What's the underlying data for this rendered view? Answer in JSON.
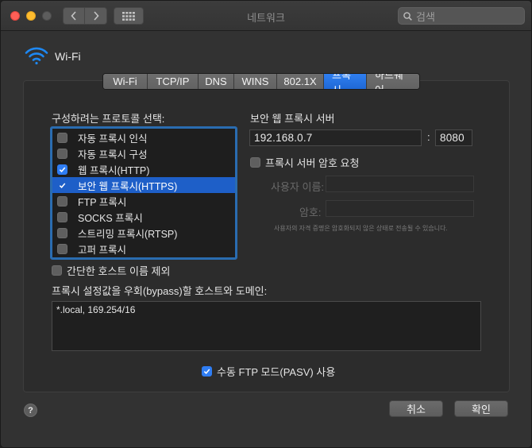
{
  "window": {
    "title": "네트워크"
  },
  "search": {
    "placeholder": "검색"
  },
  "header": {
    "service_name": "Wi-Fi"
  },
  "tabs": [
    {
      "label": "Wi-Fi"
    },
    {
      "label": "TCP/IP"
    },
    {
      "label": "DNS"
    },
    {
      "label": "WINS"
    },
    {
      "label": "802.1X"
    },
    {
      "label": "프록시"
    },
    {
      "label": "하드웨어"
    }
  ],
  "active_tab": "프록시",
  "protocols": {
    "title": "구성하려는 프로토콜 선택:",
    "items": [
      {
        "label": "자동 프록시 인식",
        "checked": false,
        "selected": false
      },
      {
        "label": "자동 프록시 구성",
        "checked": false,
        "selected": false
      },
      {
        "label": "웹 프록시(HTTP)",
        "checked": true,
        "selected": false
      },
      {
        "label": "보안 웹 프록시(HTTPS)",
        "checked": true,
        "selected": true
      },
      {
        "label": "FTP 프록시",
        "checked": false,
        "selected": false
      },
      {
        "label": "SOCKS 프록시",
        "checked": false,
        "selected": false
      },
      {
        "label": "스트리밍 프록시(RTSP)",
        "checked": false,
        "selected": false
      },
      {
        "label": "고퍼 프록시",
        "checked": false,
        "selected": false
      }
    ]
  },
  "simple_hosts": {
    "label": "간단한 호스트 이름 제외",
    "checked": false
  },
  "server": {
    "title": "보안 웹 프록시 서버",
    "host": "192.168.0.7",
    "separator": ":",
    "port": "8080"
  },
  "auth": {
    "label": "프록시 서버 암호 요청",
    "checked": false,
    "username_label": "사용자 이름:",
    "password_label": "암호:",
    "hint": "사용자의 자격 증명은 암호화되지 않은 상태로 전송될 수 있습니다."
  },
  "bypass": {
    "label": "프록시 설정값을 우회(bypass)할 호스트와 도메인:",
    "value": "*.local, 169.254/16"
  },
  "pasv": {
    "label": "수동 FTP 모드(PASV) 사용",
    "checked": true
  },
  "footer": {
    "help": "?",
    "cancel": "취소",
    "ok": "확인"
  }
}
